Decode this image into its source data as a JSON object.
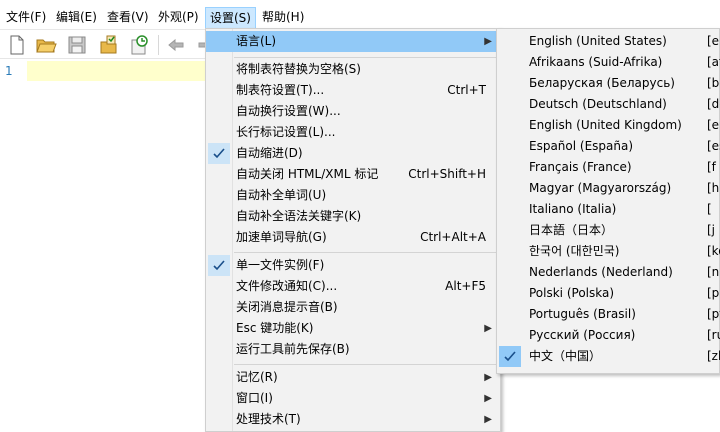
{
  "menubar": {
    "items": [
      {
        "label": "文件(F)"
      },
      {
        "label": "编辑(E)"
      },
      {
        "label": "查看(V)"
      },
      {
        "label": "外观(P)"
      },
      {
        "label": "设置(S)"
      },
      {
        "label": "帮助(H)"
      }
    ]
  },
  "toolbar": {
    "icons": [
      "new-file-icon",
      "open-folder-icon",
      "save-icon",
      "save-all-icon",
      "reload-icon",
      "undo-icon",
      "redo-icon"
    ]
  },
  "editor": {
    "line_number": "1"
  },
  "settings_menu": {
    "items": [
      {
        "label": "语言(L)",
        "shortcut": "",
        "submenu": true,
        "checked": false
      },
      {
        "label": "将制表符替换为空格(S)",
        "shortcut": "",
        "submenu": false,
        "checked": false
      },
      {
        "label": "制表符设置(T)...",
        "shortcut": "Ctrl+T",
        "submenu": false,
        "checked": false
      },
      {
        "label": "自动换行设置(W)...",
        "shortcut": "",
        "submenu": false,
        "checked": false
      },
      {
        "label": "长行标记设置(L)...",
        "shortcut": "",
        "submenu": false,
        "checked": false
      },
      {
        "label": "自动缩进(D)",
        "shortcut": "",
        "submenu": false,
        "checked": true
      },
      {
        "label": "自动关闭 HTML/XML 标记",
        "shortcut": "Ctrl+Shift+H",
        "submenu": false,
        "checked": false
      },
      {
        "label": "自动补全单词(U)",
        "shortcut": "",
        "submenu": false,
        "checked": false
      },
      {
        "label": "自动补全语法关键字(K)",
        "shortcut": "",
        "submenu": false,
        "checked": false
      },
      {
        "label": "加速单词导航(G)",
        "shortcut": "Ctrl+Alt+A",
        "submenu": false,
        "checked": false
      },
      {
        "label": "单一文件实例(F)",
        "shortcut": "",
        "submenu": false,
        "checked": true
      },
      {
        "label": "文件修改通知(C)...",
        "shortcut": "Alt+F5",
        "submenu": false,
        "checked": false
      },
      {
        "label": "关闭消息提示音(B)",
        "shortcut": "",
        "submenu": false,
        "checked": false
      },
      {
        "label": "Esc 键功能(K)",
        "shortcut": "",
        "submenu": true,
        "checked": false
      },
      {
        "label": "运行工具前先保存(B)",
        "shortcut": "",
        "submenu": false,
        "checked": false
      },
      {
        "label": "记忆(R)",
        "shortcut": "",
        "submenu": true,
        "checked": false
      },
      {
        "label": "窗口(I)",
        "shortcut": "",
        "submenu": true,
        "checked": false
      },
      {
        "label": "处理技术(T)",
        "shortcut": "",
        "submenu": true,
        "checked": false
      }
    ]
  },
  "language_submenu": {
    "items": [
      {
        "label": "English (United States)",
        "code": "[en"
      },
      {
        "label": "Afrikaans (Suid-Afrika)",
        "code": "[af"
      },
      {
        "label": "Беларуская (Беларусь)",
        "code": "[be"
      },
      {
        "label": "Deutsch (Deutschland)",
        "code": "[de"
      },
      {
        "label": "English (United Kingdom)",
        "code": "[en"
      },
      {
        "label": "Español (España)",
        "code": "[es"
      },
      {
        "label": "Français (France)",
        "code": "[f"
      },
      {
        "label": "Magyar (Magyarország)",
        "code": "[hu"
      },
      {
        "label": "Italiano (Italia)",
        "code": "["
      },
      {
        "label": "日本語（日本）",
        "code": "[j"
      },
      {
        "label": "한국어 (대한민국)",
        "code": "[ko"
      },
      {
        "label": "Nederlands (Nederland)",
        "code": "[n"
      },
      {
        "label": "Polski (Polska)",
        "code": "[p"
      },
      {
        "label": "Português (Brasil)",
        "code": "[pt"
      },
      {
        "label": "Русский (Россия)",
        "code": "[ru"
      },
      {
        "label": "中文（中国）",
        "code": "[zh",
        "checked": true
      }
    ]
  },
  "colors": {
    "menu_highlight": "#91c9f7",
    "menubar_active": "#cce8ff",
    "current_line": "#ffffcc"
  }
}
